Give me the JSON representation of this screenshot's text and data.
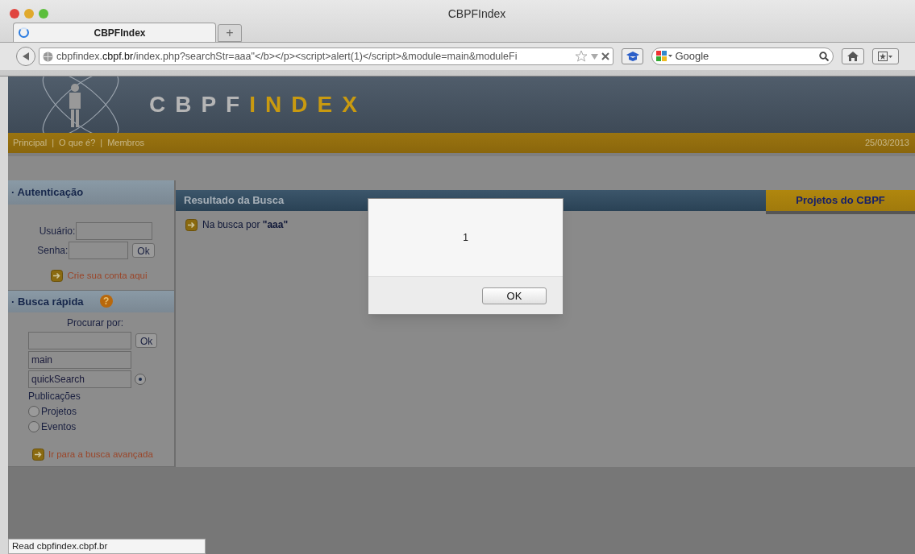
{
  "window": {
    "title": "CBPFIndex"
  },
  "tabs": [
    {
      "label": "CBPFIndex",
      "selected": true,
      "loading": true
    }
  ],
  "new_tab": "+",
  "address_bar": {
    "url": "cbpfindex.**cbpf.br**/index.php?searchStr=aaa\"</b></p><script>alert(1)</script>&module=main&moduleFi"
  },
  "search_bar": {
    "placeholder": "Google"
  },
  "site": {
    "logo_parts": [
      "CBPF",
      "INDEX"
    ],
    "nav": [
      {
        "label": "Principal"
      },
      {
        "label": "O que é?"
      },
      {
        "label": "Membros"
      }
    ],
    "nav_separator": "|",
    "date": "25/03/2013"
  },
  "login": {
    "title": "· Autenticação",
    "user_label": "Usuário:",
    "password_label": "Senha:",
    "submit": "Ok",
    "create_account": "Crie sua conta aqui"
  },
  "quick_search": {
    "title": "· Busca rápida",
    "help": "?",
    "prompt": "Procurar por:",
    "submit": "Ok",
    "fields": [
      "main",
      "quickSearch"
    ],
    "options": [
      {
        "label": "Publicações",
        "selected": true
      },
      {
        "label": "Projetos",
        "selected": false
      },
      {
        "label": "Eventos",
        "selected": false
      }
    ],
    "advanced_link": "Ir para a busca avançada"
  },
  "results": {
    "title": "Resultado da Busca",
    "message": "Na busca por **\"aaa\"**"
  },
  "side_panel": {
    "title": "Projetos do CBPF"
  },
  "alert": {
    "message": "1",
    "button": "OK"
  },
  "status_bar": "Read cbpfindex.cbpf.br"
}
